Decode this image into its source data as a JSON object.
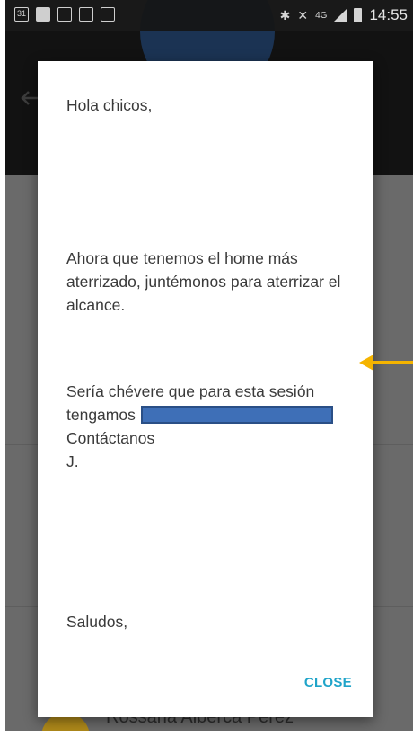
{
  "status_bar": {
    "time": "14:55",
    "network": "4G",
    "left_icons": [
      "calendar-31-icon",
      "youtube-icon",
      "gallery-icon",
      "missed-call-icon",
      "calendar-icon"
    ],
    "right_icons": [
      "bluetooth-icon",
      "mute-icon",
      "signal-icon",
      "battery-icon"
    ]
  },
  "background": {
    "contact_name": "Rossana Alberca Pérez"
  },
  "dialog": {
    "greeting": "Hola chicos,",
    "paragraph1": "Ahora que tenemos el home más aterrizado, juntémonos para aterrizar el alcance.",
    "paragraph2_start": "Sería chévere que para esta sesión tengamos",
    "redacted_text": "[redacted]",
    "contact_line": "Contáctanos",
    "signature": "J.",
    "closing": "Saludos,",
    "close_label": "CLOSE"
  },
  "colors": {
    "accent": "#1fa4c9",
    "annotation_arrow": "#f5b400",
    "redaction": "#3e6fb7"
  }
}
